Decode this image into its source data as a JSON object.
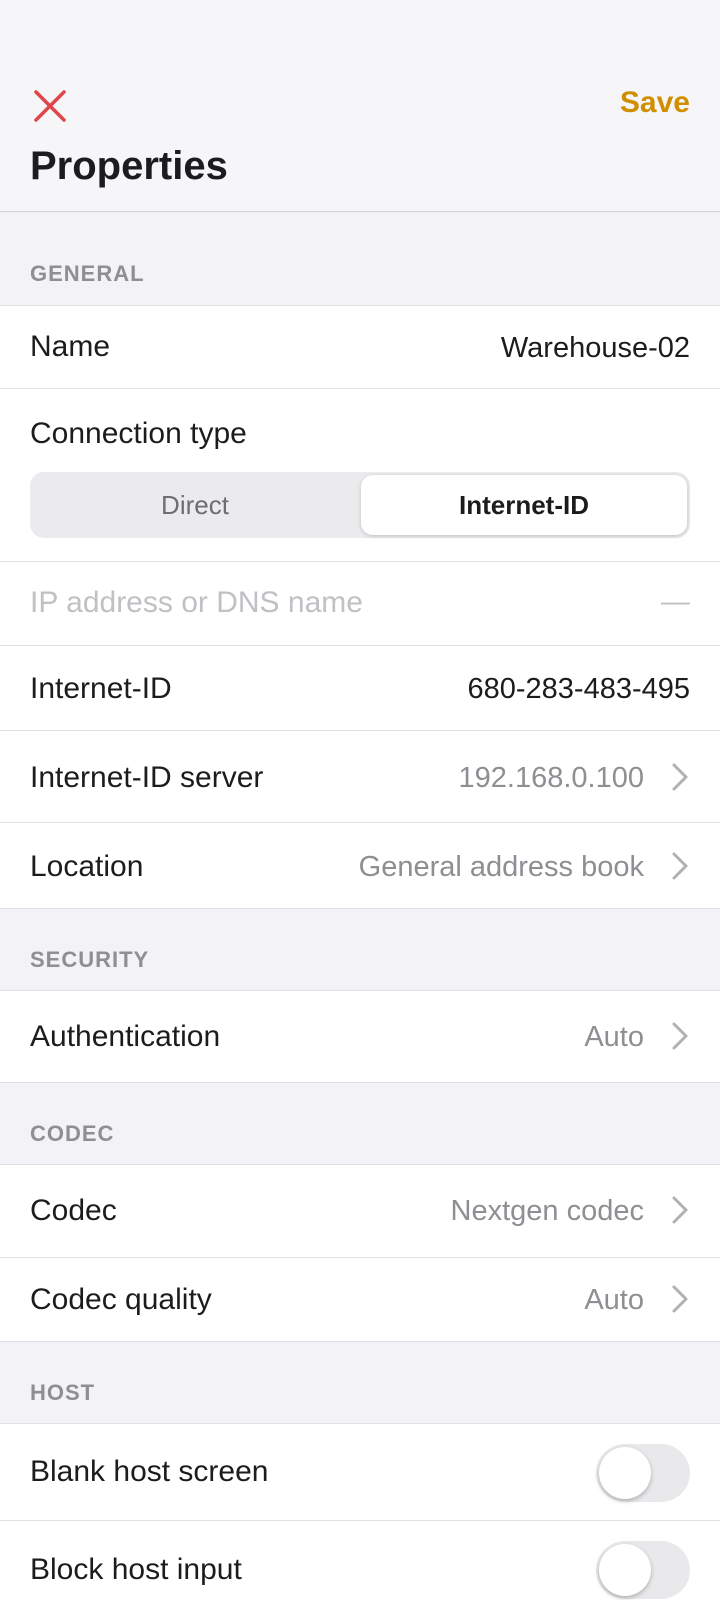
{
  "header": {
    "title": "Properties",
    "save_label": "Save",
    "close_icon": "close-icon",
    "accent_color": "#d18f00",
    "close_color": "#e0454a"
  },
  "sections": {
    "general": "GENERAL",
    "security": "SECURITY",
    "codec": "CODEC",
    "host": "HOST"
  },
  "general": {
    "name_label": "Name",
    "name_value": "Warehouse-02",
    "connection_type_label": "Connection type",
    "connection_options": [
      "Direct",
      "Internet-ID"
    ],
    "connection_selected": "Internet-ID",
    "address_placeholder": "IP address or DNS name",
    "address_value": "—",
    "internet_id_label": "Internet-ID",
    "internet_id_value": "680-283-483-495",
    "server_label": "Internet-ID server",
    "server_value": "192.168.0.100",
    "location_label": "Location",
    "location_value": "General address book"
  },
  "security": {
    "auth_label": "Authentication",
    "auth_value": "Auto"
  },
  "codec": {
    "codec_label": "Codec",
    "codec_value": "Nextgen codec",
    "quality_label": "Codec quality",
    "quality_value": "Auto"
  },
  "host": {
    "blank_label": "Blank host screen",
    "blank_on": false,
    "block_label": "Block host input",
    "block_on": false
  }
}
